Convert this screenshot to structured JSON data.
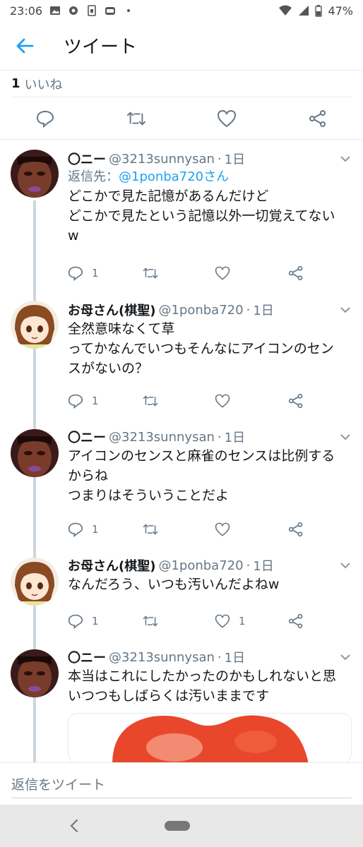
{
  "status_bar": {
    "time": "23:06",
    "battery": "47%",
    "icons_left": [
      "image-icon",
      "gear-icon",
      "sim-icon",
      "app-icon",
      "dot-icon"
    ],
    "icons_right": [
      "wifi-icon",
      "signal-icon",
      "battery-icon"
    ]
  },
  "header": {
    "title": "ツイート"
  },
  "likes": {
    "count": "1",
    "label": "いいね"
  },
  "replies": [
    {
      "name": "〇ニー",
      "handle": "@3213sunnysan",
      "dot": "·",
      "time": "1日",
      "reply_to_prefix": "返信先：",
      "reply_to_mention": "@1ponba720さん",
      "text": "どこかで見た記憶があるんだけど\nどこかで見たという記憶以外一切覚えてない\nw",
      "reply_count": "1",
      "retweet_count": "",
      "like_count": ""
    },
    {
      "name": "お母さん(棋聖)",
      "handle": "@1ponba720",
      "dot": "·",
      "time": "1日",
      "text": "全然意味なくて草\nってかなんでいつもそんなにアイコンのセン\nスがないの？",
      "reply_count": "1",
      "retweet_count": "",
      "like_count": ""
    },
    {
      "name": "〇ニー",
      "handle": "@3213sunnysan",
      "dot": "·",
      "time": "1日",
      "text": "アイコンのセンスと麻雀のセンスは比例する\nからね\nつまりはそういうことだよ",
      "reply_count": "1",
      "retweet_count": "",
      "like_count": ""
    },
    {
      "name": "お母さん(棋聖)",
      "handle": "@1ponba720",
      "dot": "·",
      "time": "1日",
      "text": "なんだろう、いつも汚いんだよねw",
      "reply_count": "1",
      "retweet_count": "",
      "like_count": "1"
    },
    {
      "name": "〇ニー",
      "handle": "@3213sunnysan",
      "dot": "·",
      "time": "1日",
      "text": "本当はこれにしたかったのかもしれないと思\nいつつもしばらくは汚いままです"
    }
  ],
  "compose": {
    "placeholder": "返信をツイート"
  },
  "colors": {
    "accent": "#1da1f2",
    "text_primary": "#14171a",
    "text_secondary": "#657786",
    "thread_line": "#ccd6dd",
    "media_red": "#e8472c"
  }
}
